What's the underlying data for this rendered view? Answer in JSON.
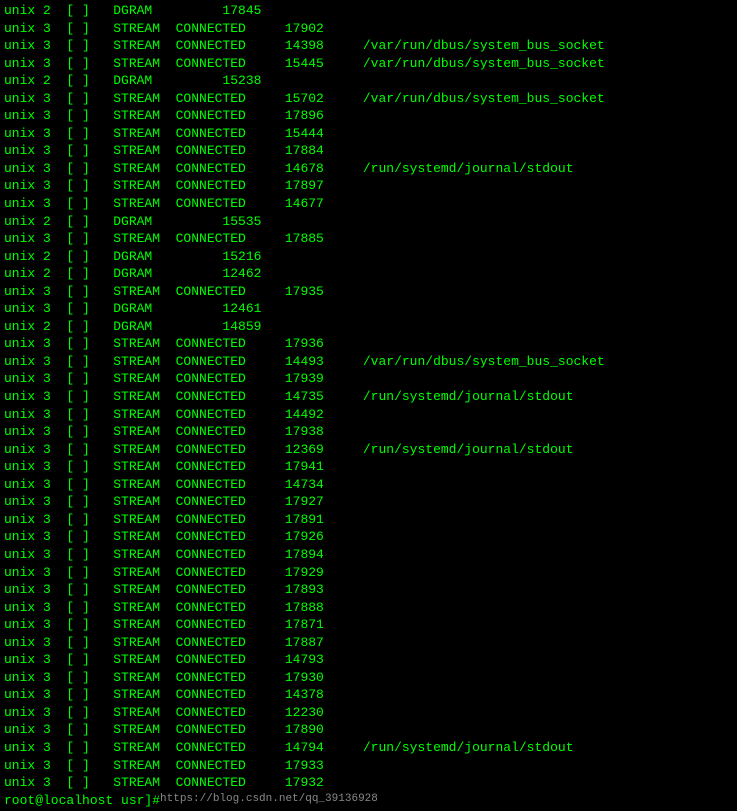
{
  "terminal": {
    "lines": [
      {
        "cmd": "unix",
        "num": "2",
        "bracket": "[ ]",
        "type": "DGRAM",
        "state": "",
        "inode": "17845",
        "path": ""
      },
      {
        "cmd": "unix",
        "num": "3",
        "bracket": "[ ]",
        "type": "STREAM",
        "state": "CONNECTED",
        "inode": "17902",
        "path": ""
      },
      {
        "cmd": "unix",
        "num": "3",
        "bracket": "[ ]",
        "type": "STREAM",
        "state": "CONNECTED",
        "inode": "14398",
        "path": "/var/run/dbus/system_bus_socket"
      },
      {
        "cmd": "unix",
        "num": "3",
        "bracket": "[ ]",
        "type": "STREAM",
        "state": "CONNECTED",
        "inode": "15445",
        "path": "/var/run/dbus/system_bus_socket"
      },
      {
        "cmd": "unix",
        "num": "2",
        "bracket": "[ ]",
        "type": "DGRAM",
        "state": "",
        "inode": "15238",
        "path": ""
      },
      {
        "cmd": "unix",
        "num": "3",
        "bracket": "[ ]",
        "type": "STREAM",
        "state": "CONNECTED",
        "inode": "15702",
        "path": "/var/run/dbus/system_bus_socket"
      },
      {
        "cmd": "unix",
        "num": "3",
        "bracket": "[ ]",
        "type": "STREAM",
        "state": "CONNECTED",
        "inode": "17896",
        "path": ""
      },
      {
        "cmd": "unix",
        "num": "3",
        "bracket": "[ ]",
        "type": "STREAM",
        "state": "CONNECTED",
        "inode": "15444",
        "path": ""
      },
      {
        "cmd": "unix",
        "num": "3",
        "bracket": "[ ]",
        "type": "STREAM",
        "state": "CONNECTED",
        "inode": "17884",
        "path": ""
      },
      {
        "cmd": "unix",
        "num": "3",
        "bracket": "[ ]",
        "type": "STREAM",
        "state": "CONNECTED",
        "inode": "14678",
        "path": "/run/systemd/journal/stdout"
      },
      {
        "cmd": "unix",
        "num": "3",
        "bracket": "[ ]",
        "type": "STREAM",
        "state": "CONNECTED",
        "inode": "17897",
        "path": ""
      },
      {
        "cmd": "unix",
        "num": "3",
        "bracket": "[ ]",
        "type": "STREAM",
        "state": "CONNECTED",
        "inode": "14677",
        "path": ""
      },
      {
        "cmd": "unix",
        "num": "2",
        "bracket": "[ ]",
        "type": "DGRAM",
        "state": "",
        "inode": "15535",
        "path": ""
      },
      {
        "cmd": "unix",
        "num": "3",
        "bracket": "[ ]",
        "type": "STREAM",
        "state": "CONNECTED",
        "inode": "17885",
        "path": ""
      },
      {
        "cmd": "unix",
        "num": "2",
        "bracket": "[ ]",
        "type": "DGRAM",
        "state": "",
        "inode": "15216",
        "path": ""
      },
      {
        "cmd": "unix",
        "num": "2",
        "bracket": "[ ]",
        "type": "DGRAM",
        "state": "",
        "inode": "12462",
        "path": ""
      },
      {
        "cmd": "unix",
        "num": "3",
        "bracket": "[ ]",
        "type": "STREAM",
        "state": "CONNECTED",
        "inode": "17935",
        "path": ""
      },
      {
        "cmd": "unix",
        "num": "3",
        "bracket": "[ ]",
        "type": "DGRAM",
        "state": "",
        "inode": "12461",
        "path": ""
      },
      {
        "cmd": "unix",
        "num": "2",
        "bracket": "[ ]",
        "type": "DGRAM",
        "state": "",
        "inode": "14859",
        "path": ""
      },
      {
        "cmd": "unix",
        "num": "3",
        "bracket": "[ ]",
        "type": "STREAM",
        "state": "CONNECTED",
        "inode": "17936",
        "path": ""
      },
      {
        "cmd": "unix",
        "num": "3",
        "bracket": "[ ]",
        "type": "STREAM",
        "state": "CONNECTED",
        "inode": "14493",
        "path": "/var/run/dbus/system_bus_socket"
      },
      {
        "cmd": "unix",
        "num": "3",
        "bracket": "[ ]",
        "type": "STREAM",
        "state": "CONNECTED",
        "inode": "17939",
        "path": ""
      },
      {
        "cmd": "unix",
        "num": "3",
        "bracket": "[ ]",
        "type": "STREAM",
        "state": "CONNECTED",
        "inode": "14735",
        "path": "/run/systemd/journal/stdout"
      },
      {
        "cmd": "unix",
        "num": "3",
        "bracket": "[ ]",
        "type": "STREAM",
        "state": "CONNECTED",
        "inode": "14492",
        "path": ""
      },
      {
        "cmd": "unix",
        "num": "3",
        "bracket": "[ ]",
        "type": "STREAM",
        "state": "CONNECTED",
        "inode": "17938",
        "path": ""
      },
      {
        "cmd": "unix",
        "num": "3",
        "bracket": "[ ]",
        "type": "STREAM",
        "state": "CONNECTED",
        "inode": "12369",
        "path": "/run/systemd/journal/stdout"
      },
      {
        "cmd": "unix",
        "num": "3",
        "bracket": "[ ]",
        "type": "STREAM",
        "state": "CONNECTED",
        "inode": "17941",
        "path": ""
      },
      {
        "cmd": "unix",
        "num": "3",
        "bracket": "[ ]",
        "type": "STREAM",
        "state": "CONNECTED",
        "inode": "14734",
        "path": ""
      },
      {
        "cmd": "unix",
        "num": "3",
        "bracket": "[ ]",
        "type": "STREAM",
        "state": "CONNECTED",
        "inode": "17927",
        "path": ""
      },
      {
        "cmd": "unix",
        "num": "3",
        "bracket": "[ ]",
        "type": "STREAM",
        "state": "CONNECTED",
        "inode": "17891",
        "path": ""
      },
      {
        "cmd": "unix",
        "num": "3",
        "bracket": "[ ]",
        "type": "STREAM",
        "state": "CONNECTED",
        "inode": "17926",
        "path": ""
      },
      {
        "cmd": "unix",
        "num": "3",
        "bracket": "[ ]",
        "type": "STREAM",
        "state": "CONNECTED",
        "inode": "17894",
        "path": ""
      },
      {
        "cmd": "unix",
        "num": "3",
        "bracket": "[ ]",
        "type": "STREAM",
        "state": "CONNECTED",
        "inode": "17929",
        "path": ""
      },
      {
        "cmd": "unix",
        "num": "3",
        "bracket": "[ ]",
        "type": "STREAM",
        "state": "CONNECTED",
        "inode": "17893",
        "path": ""
      },
      {
        "cmd": "unix",
        "num": "3",
        "bracket": "[ ]",
        "type": "STREAM",
        "state": "CONNECTED",
        "inode": "17888",
        "path": ""
      },
      {
        "cmd": "unix",
        "num": "3",
        "bracket": "[ ]",
        "type": "STREAM",
        "state": "CONNECTED",
        "inode": "17871",
        "path": ""
      },
      {
        "cmd": "unix",
        "num": "3",
        "bracket": "[ ]",
        "type": "STREAM",
        "state": "CONNECTED",
        "inode": "17887",
        "path": ""
      },
      {
        "cmd": "unix",
        "num": "3",
        "bracket": "[ ]",
        "type": "STREAM",
        "state": "CONNECTED",
        "inode": "14793",
        "path": ""
      },
      {
        "cmd": "unix",
        "num": "3",
        "bracket": "[ ]",
        "type": "STREAM",
        "state": "CONNECTED",
        "inode": "17930",
        "path": ""
      },
      {
        "cmd": "unix",
        "num": "3",
        "bracket": "[ ]",
        "type": "STREAM",
        "state": "CONNECTED",
        "inode": "14378",
        "path": ""
      },
      {
        "cmd": "unix",
        "num": "3",
        "bracket": "[ ]",
        "type": "STREAM",
        "state": "CONNECTED",
        "inode": "12230",
        "path": ""
      },
      {
        "cmd": "unix",
        "num": "3",
        "bracket": "[ ]",
        "type": "STREAM",
        "state": "CONNECTED",
        "inode": "17890",
        "path": ""
      },
      {
        "cmd": "unix",
        "num": "3",
        "bracket": "[ ]",
        "type": "STREAM",
        "state": "CONNECTED",
        "inode": "14794",
        "path": "/run/systemd/journal/stdout"
      },
      {
        "cmd": "unix",
        "num": "3",
        "bracket": "[ ]",
        "type": "STREAM",
        "state": "CONNECTED",
        "inode": "17933",
        "path": ""
      },
      {
        "cmd": "unix",
        "num": "3",
        "bracket": "[ ]",
        "type": "STREAM",
        "state": "CONNECTED",
        "inode": "17932",
        "path": ""
      }
    ],
    "prompt": "root@localhost usr]#",
    "watermark": "https://blog.csdn.net/qq_39136928"
  }
}
